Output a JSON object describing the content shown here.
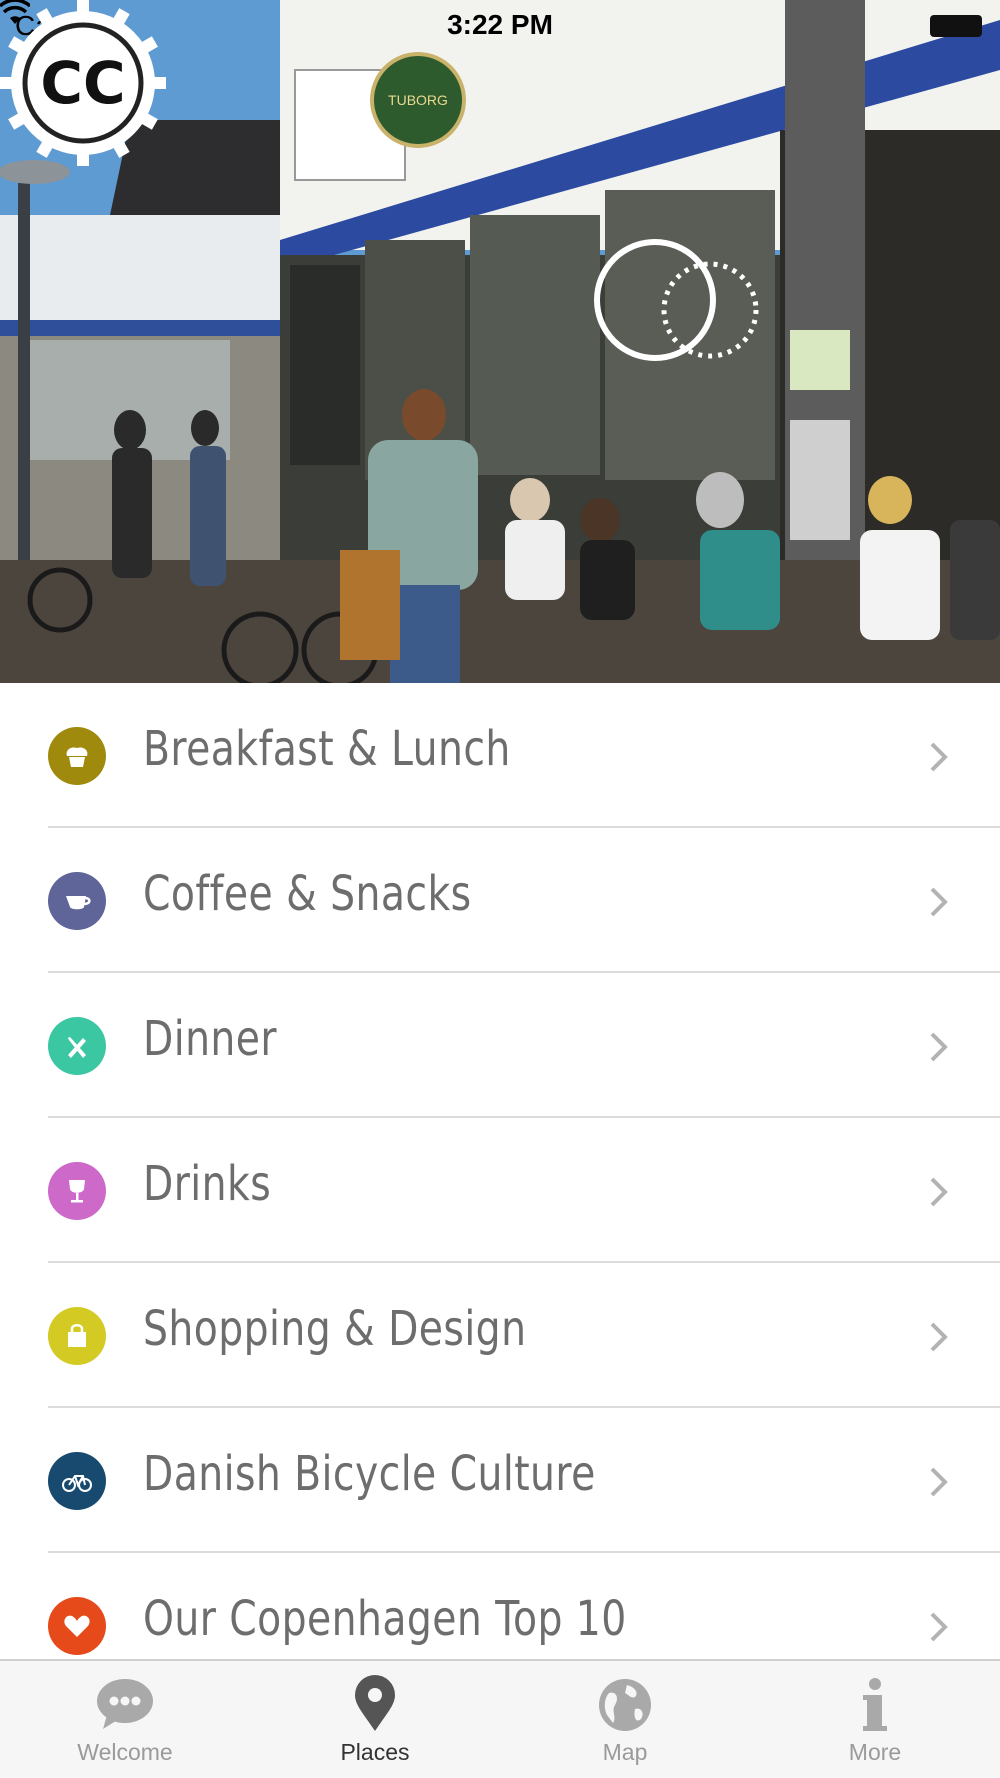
{
  "status_bar": {
    "carrier": "Carrier",
    "time": "3:22 PM"
  },
  "hero": {
    "image": "street-cafe-photo",
    "logo": "CC"
  },
  "categories": [
    {
      "label": "Breakfast & Lunch",
      "icon": "muffin-icon",
      "color": "#a08a0e"
    },
    {
      "label": "Coffee & Snacks",
      "icon": "coffee-cup-icon",
      "color": "#5f6599"
    },
    {
      "label": "Dinner",
      "icon": "fork-knife-icon",
      "color": "#3cc7a3"
    },
    {
      "label": "Drinks",
      "icon": "wine-glass-icon",
      "color": "#cc69c9"
    },
    {
      "label": "Shopping & Design",
      "icon": "shopping-bag-icon",
      "color": "#d4ca24"
    },
    {
      "label": "Danish Bicycle Culture",
      "icon": "bicycle-icon",
      "color": "#174a6e"
    },
    {
      "label": "Our Copenhagen Top 10",
      "icon": "heart-icon",
      "color": "#e64a1a"
    }
  ],
  "tabbar": {
    "active": "Places",
    "tabs": [
      {
        "label": "Welcome",
        "icon": "chat-bubble-icon"
      },
      {
        "label": "Places",
        "icon": "map-pin-icon"
      },
      {
        "label": "Map",
        "icon": "globe-icon"
      },
      {
        "label": "More",
        "icon": "info-icon"
      }
    ]
  }
}
